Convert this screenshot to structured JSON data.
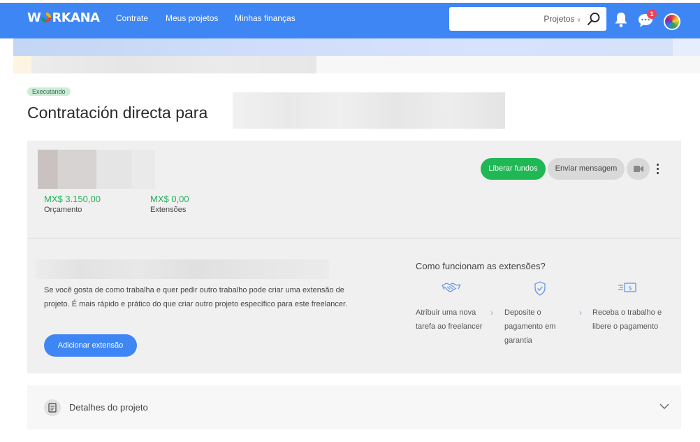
{
  "nav": {
    "logo": {
      "pre": "W",
      "post": "RKANA"
    },
    "links": [
      "Contrate",
      "Meus projetos",
      "Minhas finanças"
    ],
    "search": {
      "value": "",
      "scope": "Projetos"
    },
    "notification_count": "1",
    "colors": {
      "bar": "#3f86f5",
      "badge": "#ef4056"
    }
  },
  "header": {
    "status": "Executando",
    "title": "Contratación directa para"
  },
  "contract": {
    "budget_value": "MX$ 3.150,00",
    "budget_label": "Orçamento",
    "extensions_value": "MX$ 0,00",
    "extensions_label": "Extensões",
    "actions": {
      "release_funds": "Liberar fundos",
      "send_message": "Enviar mensagem"
    }
  },
  "extension": {
    "description": "Se você gosta de como trabalha e quer pedir outro trabalho pode criar uma extensão de projeto. É mais rápido e prático do que criar outro projeto específico para este freelancer.",
    "add_button": "Adicionar extensão",
    "how_title": "Como funcionam as extensões?",
    "steps": [
      {
        "icon": "handshake-icon",
        "text": "Atribuir uma nova tarefa ao freelancer"
      },
      {
        "icon": "shield-check-icon",
        "text": "Deposite o pagamento em garantia"
      },
      {
        "icon": "money-transfer-icon",
        "text": "Receba o trabalho e libere o pagamento"
      }
    ]
  },
  "details": {
    "label": "Detalhes do projeto"
  }
}
